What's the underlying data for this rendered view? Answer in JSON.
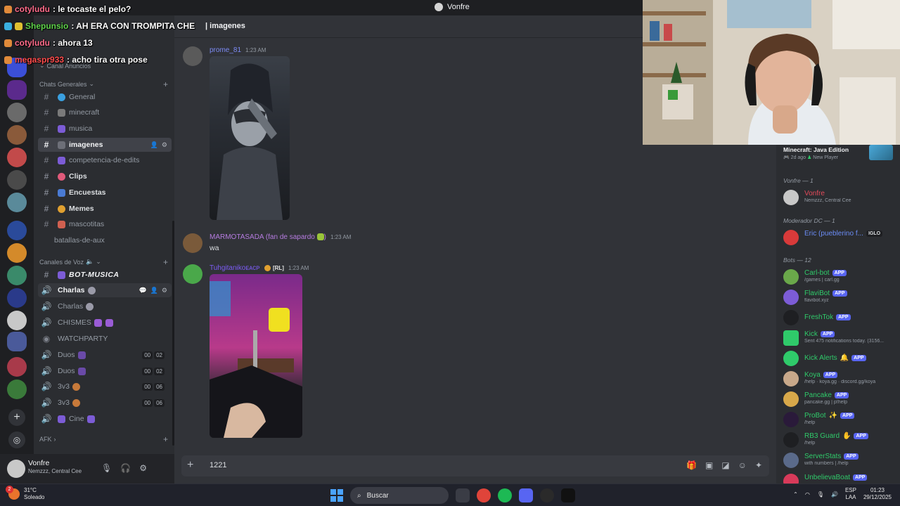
{
  "window": {
    "title": "Vonfre"
  },
  "chat_header": {
    "title": "imagenes"
  },
  "overlay": [
    {
      "user": "cotyludu",
      "text": ": le tocaste el pelo?",
      "color": "#ff6b8a"
    },
    {
      "user": "Shepunsio",
      "text": ": AH ERA CON TROMPITA CHE",
      "color": "#5fd34a"
    },
    {
      "user": "cotyludu",
      "text": ": ahora 13",
      "color": "#ff6b8a"
    },
    {
      "user": "megaspr933",
      "text": ": acho tira otra pose",
      "color": "#ff4d4d"
    }
  ],
  "sidebar": {
    "categories": [
      {
        "label": "Canal Anuncios"
      },
      {
        "label": "Chats Generales"
      },
      {
        "label": "Canales de Voz"
      },
      {
        "label": "AFK"
      }
    ],
    "text_channels": [
      {
        "label": "General",
        "color": "#3aa0e0"
      },
      {
        "label": "minecraft",
        "color": "#7a7a7a"
      },
      {
        "label": "musica",
        "color": "#7c5cd6"
      },
      {
        "label": "imagenes",
        "color": "#6d6f78"
      },
      {
        "label": "competencia-de-edits",
        "color": "#7c5cd6"
      },
      {
        "label": "Clips",
        "color": "#e05a7a"
      },
      {
        "label": "Encuestas",
        "color": "#4a7bd4"
      },
      {
        "label": "Memes",
        "color": "#e0a030"
      },
      {
        "label": "mascotitas",
        "color": "#d06050"
      },
      {
        "label": "batallas-de-aux",
        "color": ""
      }
    ],
    "voice_channels": [
      {
        "label": "BOT-MUSICA",
        "kind": "text"
      },
      {
        "label": "Charlas",
        "kind": "voice"
      },
      {
        "label": "Charlas",
        "kind": "voice"
      },
      {
        "label": "CHISMES",
        "kind": "voice"
      },
      {
        "label": "WATCHPARTY",
        "kind": "stage"
      },
      {
        "label": "Duos",
        "kind": "voice",
        "count": "00",
        "limit": "02"
      },
      {
        "label": "Duos",
        "kind": "voice",
        "count": "00",
        "limit": "02"
      },
      {
        "label": "3v3",
        "kind": "voice",
        "count": "00",
        "limit": "06"
      },
      {
        "label": "3v3",
        "kind": "voice",
        "count": "00",
        "limit": "06"
      },
      {
        "label": "Cine",
        "kind": "voice"
      }
    ]
  },
  "user_panel": {
    "name": "Vonfre",
    "status": "Nemzzz, Central Cee"
  },
  "messages": [
    {
      "author": "prome_81",
      "time": "1:23 AM",
      "color": "#7c8bf5"
    },
    {
      "author": "MARMOTASADA (fan de sapardo",
      "time": "1:23 AM",
      "text": "wa",
      "color": "#b67ce0"
    },
    {
      "author": "Tuhgitanikoᴇᴀᴄᴘ",
      "tag": "[RL]",
      "time": "1:23 AM",
      "color": "#7c5cf5"
    }
  ],
  "composer": {
    "value": "1221"
  },
  "members": {
    "activity": {
      "title": "Minecraft: Java Edition",
      "sub": "2d ago",
      "sub2": "New Player"
    },
    "groups": [
      {
        "label": "Vonfre — 1"
      },
      {
        "label": "Moderador DC — 1"
      },
      {
        "label": "Bots — 12"
      }
    ],
    "list": [
      {
        "name": "Vonfre",
        "sub": "Nemzzz, Central Cee",
        "color": "#e24a5a",
        "badge": ""
      },
      {
        "name": "Eric (pueblerino f...",
        "sub": "",
        "color": "#6b8cf5",
        "badge": "IGLO"
      },
      {
        "name": "Carl-bot",
        "sub": "/games | carl.gg",
        "color": "#2fca6a",
        "badge": "APP"
      },
      {
        "name": "FlaviBot",
        "sub": "flavibot.xyz",
        "color": "#2fca6a",
        "badge": "APP"
      },
      {
        "name": "FreshTok",
        "sub": "",
        "color": "#2fca6a",
        "badge": "APP"
      },
      {
        "name": "Kick",
        "sub": "Sent 475 notifications today. (3156...",
        "color": "#2fca6a",
        "badge": "APP"
      },
      {
        "name": "Kick Alerts",
        "sub": "",
        "color": "#2fca6a",
        "badge": "APP"
      },
      {
        "name": "Koya",
        "sub": "/help · koya.gg · discord.gg/koya",
        "color": "#2fca6a",
        "badge": "APP"
      },
      {
        "name": "Pancake",
        "sub": "pancake.gg | p!help",
        "color": "#2fca6a",
        "badge": "APP"
      },
      {
        "name": "ProBot",
        "sub": "/help",
        "color": "#2fca6a",
        "badge": "APP"
      },
      {
        "name": "RB3 Guard",
        "sub": "/help",
        "color": "#2fca6a",
        "badge": "APP"
      },
      {
        "name": "ServerStats",
        "sub": "with numbers | /help",
        "color": "#2fca6a",
        "badge": "APP"
      },
      {
        "name": "UnbelievaBoat",
        "sub": "",
        "color": "#2fca6a",
        "badge": "APP"
      }
    ]
  },
  "taskbar": {
    "weather_temp": "31°C",
    "weather_desc": "Soleado",
    "weather_badge": "2",
    "search": "Buscar",
    "lang1": "ESP",
    "lang2": "LAA",
    "time": "01:23",
    "date": "29/12/2025"
  }
}
